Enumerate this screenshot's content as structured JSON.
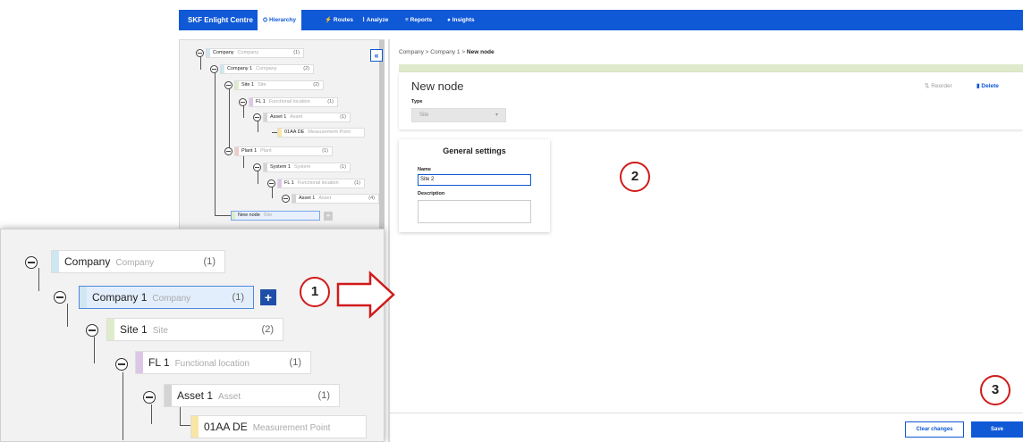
{
  "nav": {
    "brand": "SKF Enlight Centre",
    "tabs": [
      "Hierarchy",
      "Routes",
      "Analyze",
      "Reports",
      "Insights"
    ],
    "active_tab": "Hierarchy"
  },
  "tree": {
    "collapse_label": "«",
    "nodes": [
      {
        "name": "Company",
        "type": "Company",
        "count": "(1)"
      },
      {
        "name": "Company 1",
        "type": "Company",
        "count": "(2)"
      },
      {
        "name": "Site 1",
        "type": "Site",
        "count": "(2)"
      },
      {
        "name": "FL 1",
        "type": "Functional location",
        "count": "(1)"
      },
      {
        "name": "Asset 1",
        "type": "Asset",
        "count": "(1)"
      },
      {
        "name": "01AA DE",
        "type": "Measurement Point",
        "count": ""
      },
      {
        "name": "Plant 1",
        "type": "Plant",
        "count": "(1)"
      },
      {
        "name": "System 1",
        "type": "System",
        "count": "(1)"
      },
      {
        "name": "FL 1",
        "type": "Functional location",
        "count": "(1)"
      },
      {
        "name": "Asset 1",
        "type": "Asset",
        "count": "(4)"
      },
      {
        "name": "New node",
        "type": "Site",
        "count": ""
      }
    ],
    "plus_label": "+"
  },
  "breadcrumb": {
    "items": [
      "Company",
      "Company 1"
    ],
    "separator": ">",
    "current": "New node"
  },
  "node_card": {
    "title": "New node",
    "type_label": "Type",
    "type_value": "Site",
    "reorder_label": "Reorder",
    "delete_label": "Delete"
  },
  "general_settings": {
    "title": "General settings",
    "name_label": "Name",
    "name_value": "Site 2",
    "description_label": "Description"
  },
  "footer": {
    "clear_label": "Clear changes",
    "save_label": "Save"
  },
  "zoom": {
    "nodes": [
      {
        "name": "Company",
        "type": "Company",
        "count": "(1)"
      },
      {
        "name": "Company 1",
        "type": "Company",
        "count": "(1)"
      },
      {
        "name": "Site 1",
        "type": "Site",
        "count": "(2)"
      },
      {
        "name": "FL 1",
        "type": "Functional location",
        "count": "(1)"
      },
      {
        "name": "Asset 1",
        "type": "Asset",
        "count": "(1)"
      },
      {
        "name": "01AA DE",
        "type": "Measurement Point",
        "count": ""
      }
    ],
    "plus_label": "+"
  },
  "callouts": [
    "1",
    "2",
    "3"
  ],
  "colors": {
    "primary": "#0f58d6",
    "callout": "#d01a1a",
    "company_bar": "#cfe7f2",
    "site_bar": "#dfeccb",
    "fl_bar": "#dcc6e6",
    "asset_bar": "#d4d4d4",
    "mp_bar": "#f9e5a6"
  }
}
